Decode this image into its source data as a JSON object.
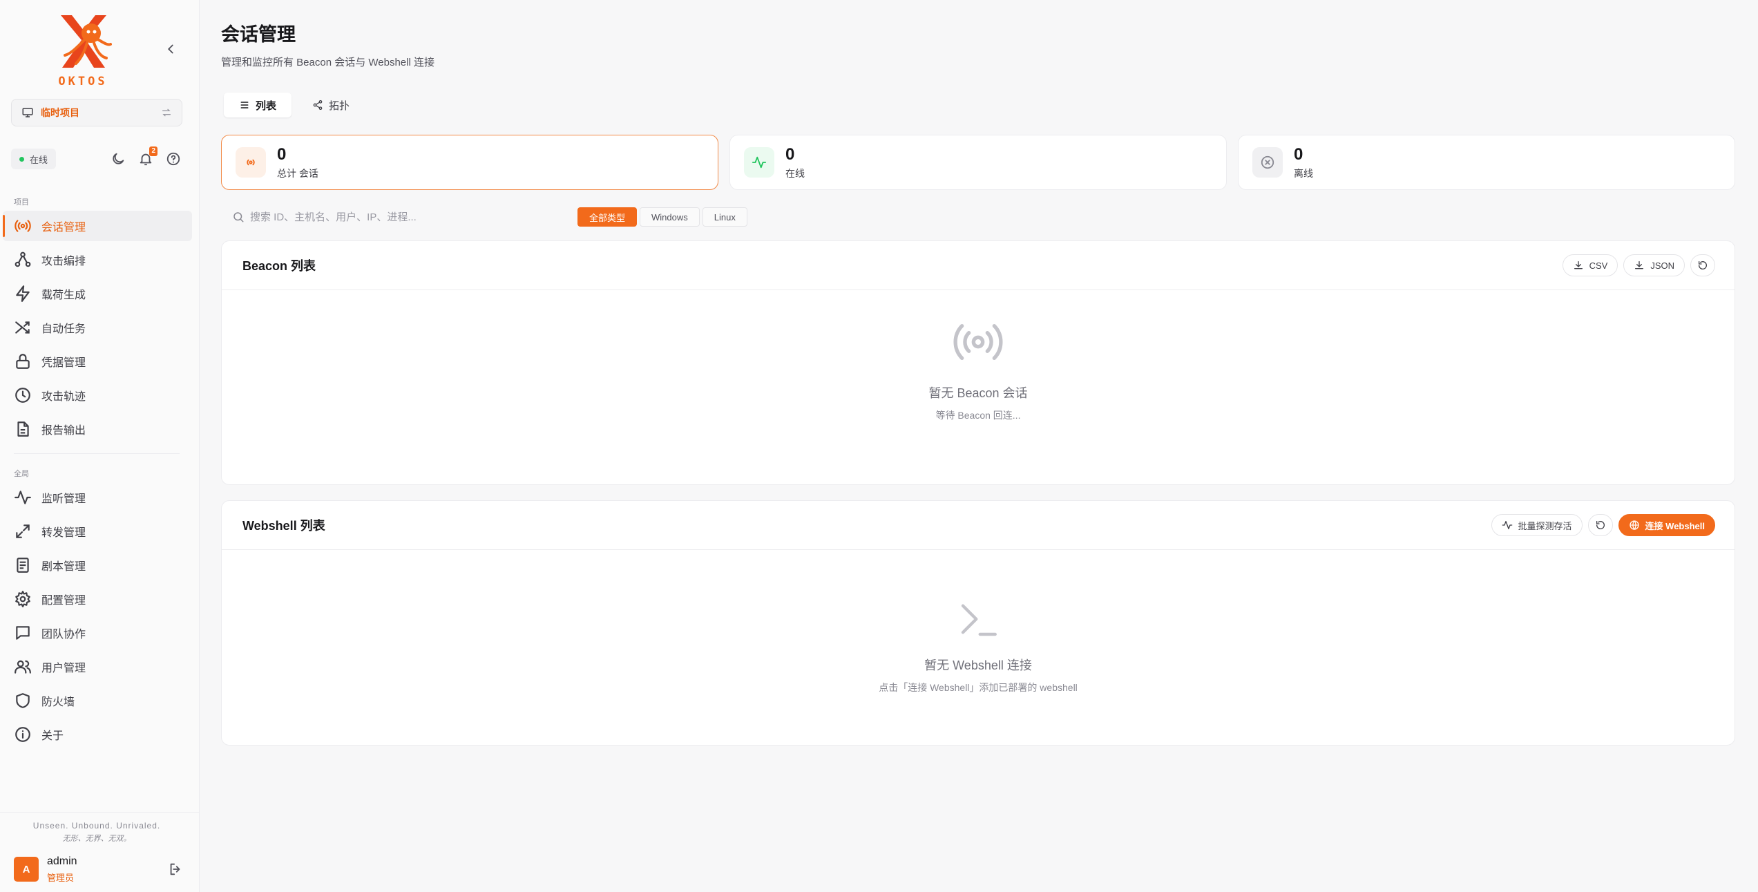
{
  "brand": {
    "name": "OKTOS",
    "accent": "#f26a1b"
  },
  "project": {
    "name": "临时项目"
  },
  "status": {
    "online_label": "在线",
    "notification_count": "2"
  },
  "nav": {
    "group_project": "项目",
    "group_global": "全局",
    "project_items": [
      {
        "label": "会话管理",
        "icon": "radio-icon"
      },
      {
        "label": "攻击编排",
        "icon": "nodes-icon"
      },
      {
        "label": "载荷生成",
        "icon": "zap-icon"
      },
      {
        "label": "自动任务",
        "icon": "shuffle-icon"
      },
      {
        "label": "凭据管理",
        "icon": "lock-icon"
      },
      {
        "label": "攻击轨迹",
        "icon": "clock-icon"
      },
      {
        "label": "报告输出",
        "icon": "file-icon"
      }
    ],
    "global_items": [
      {
        "label": "监听管理",
        "icon": "activity-icon"
      },
      {
        "label": "转发管理",
        "icon": "expand-icon"
      },
      {
        "label": "剧本管理",
        "icon": "book-icon"
      },
      {
        "label": "配置管理",
        "icon": "gear-icon"
      },
      {
        "label": "团队协作",
        "icon": "message-icon"
      },
      {
        "label": "用户管理",
        "icon": "users-icon"
      },
      {
        "label": "防火墙",
        "icon": "shield-icon"
      },
      {
        "label": "关于",
        "icon": "info-icon"
      }
    ]
  },
  "footer": {
    "slogan": "Unseen. Unbound. Unrivaled.",
    "slogan_cn": "无形、无界、无双。",
    "user": {
      "avatar": "A",
      "name": "admin",
      "role": "管理员"
    }
  },
  "page": {
    "title": "会话管理",
    "subtitle": "管理和监控所有 Beacon 会话与 Webshell 连接",
    "tabs": [
      {
        "label": "列表",
        "icon": "list-icon"
      },
      {
        "label": "拓扑",
        "icon": "share-icon"
      }
    ]
  },
  "stats": [
    {
      "value": "0",
      "label": "总计 会话",
      "icon": "radio-icon"
    },
    {
      "value": "0",
      "label": "在线",
      "icon": "activity-icon"
    },
    {
      "value": "0",
      "label": "离线",
      "icon": "x-circle-icon"
    }
  ],
  "search": {
    "placeholder": "搜索 ID、主机名、用户、IP、进程...",
    "value": ""
  },
  "filters": [
    "全部类型",
    "Windows",
    "Linux"
  ],
  "beacon_panel": {
    "title": "Beacon 列表",
    "csv_label": "CSV",
    "json_label": "JSON",
    "empty_title": "暂无 Beacon 会话",
    "empty_sub": "等待 Beacon 回连..."
  },
  "webshell_panel": {
    "title": "Webshell 列表",
    "probe_label": "批量探测存活",
    "connect_label": "连接 Webshell",
    "empty_title": "暂无 Webshell 连接",
    "empty_sub": "点击「连接 Webshell」添加已部署的 webshell"
  }
}
